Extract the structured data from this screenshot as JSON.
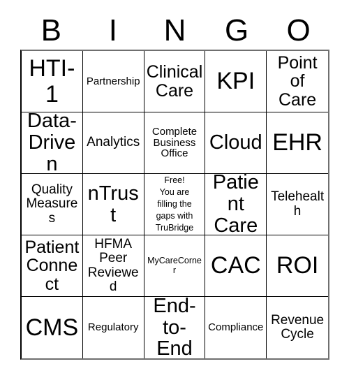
{
  "card": {
    "title": "BINGO Card",
    "header_letters": [
      "B",
      "I",
      "N",
      "G",
      "O"
    ],
    "rows": [
      [
        {
          "text": "HTI-\n1",
          "size": "xxl"
        },
        {
          "text": "Partnership",
          "size": "sm"
        },
        {
          "text": "Clinical\nCare",
          "size": "lg"
        },
        {
          "text": "KPI",
          "size": "xxl"
        },
        {
          "text": "Point\nof Care",
          "size": "lg"
        }
      ],
      [
        {
          "text": "Data-\nDriven",
          "size": "xl"
        },
        {
          "text": "Analytics",
          "size": "md"
        },
        {
          "text": "Complete\nBusiness\nOffice",
          "size": "sm"
        },
        {
          "text": "Cloud",
          "size": "xl"
        },
        {
          "text": "EHR",
          "size": "xxl"
        }
      ],
      [
        {
          "text": "Quality\nMeasures",
          "size": "md"
        },
        {
          "text": "nTrust",
          "size": "xl"
        },
        {
          "text": "Free!\nYou are\nfilling the\ngaps with\nTruBridge",
          "size": "free",
          "free_space": true
        },
        {
          "text": "Patient\nCare",
          "size": "xl"
        },
        {
          "text": "Telehealth",
          "size": "md"
        }
      ],
      [
        {
          "text": "Patient\nConnect",
          "size": "lg"
        },
        {
          "text": "HFMA\nPeer\nReviewed",
          "size": "md"
        },
        {
          "text": "MyCareCorner",
          "size": "xs"
        },
        {
          "text": "CAC",
          "size": "xxl"
        },
        {
          "text": "ROI",
          "size": "xxl"
        }
      ],
      [
        {
          "text": "CMS",
          "size": "xxl"
        },
        {
          "text": "Regulatory",
          "size": "sm"
        },
        {
          "text": "End-\nto-End",
          "size": "xl"
        },
        {
          "text": "Compliance",
          "size": "sm"
        },
        {
          "text": "Revenue\nCycle",
          "size": "md"
        }
      ]
    ]
  },
  "colors": {
    "background": "#ffffff",
    "text": "#000000",
    "grid_line": "#000000",
    "outer_border": "#6f6f6f"
  }
}
